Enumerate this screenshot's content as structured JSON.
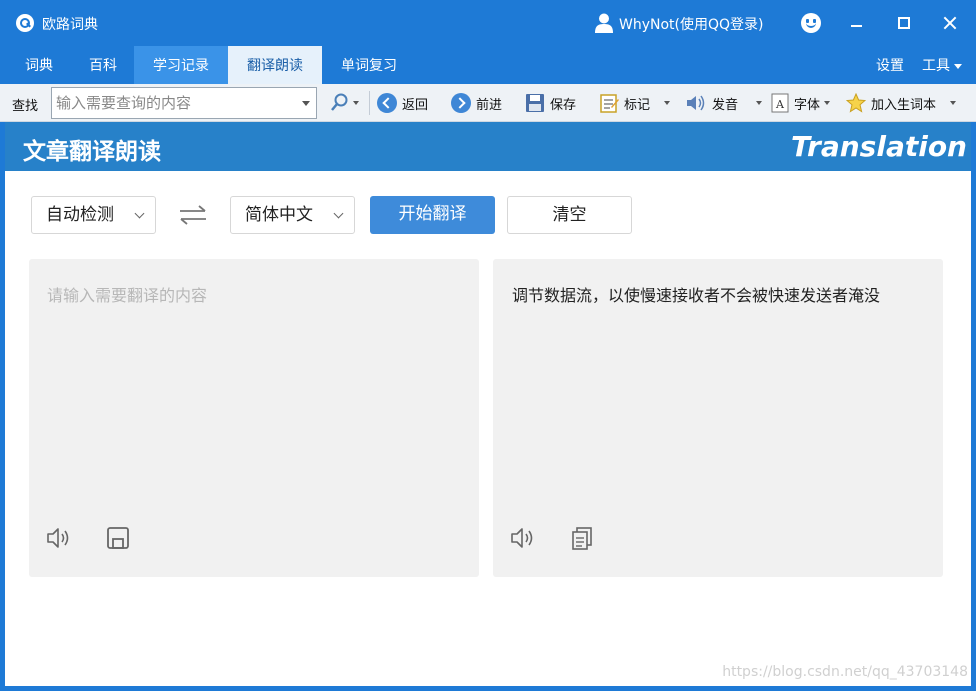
{
  "window": {
    "app_title": "欧路词典",
    "user_label": "WhyNot(使用QQ登录)",
    "icons": [
      "app-logo-icon",
      "user-icon",
      "smile-icon",
      "minimize-icon",
      "maximize-icon",
      "close-icon"
    ]
  },
  "tabs": [
    {
      "label": "词典",
      "state": "normal"
    },
    {
      "label": "百科",
      "state": "normal"
    },
    {
      "label": "学习记录",
      "state": "hover"
    },
    {
      "label": "翻译朗读",
      "state": "active"
    },
    {
      "label": "单词复习",
      "state": "normal"
    }
  ],
  "tab_right": {
    "settings": "设置",
    "tools": "工具"
  },
  "toolbar": {
    "search_label": "查找",
    "search_placeholder": "输入需要查询的内容",
    "back": "返回",
    "forward": "前进",
    "save": "保存",
    "mark": "标记",
    "pronounce": "发音",
    "font": "字体",
    "add_wordbook": "加入生词本"
  },
  "banner": {
    "title": "文章翻译朗读",
    "subtitle": "Translation"
  },
  "controls": {
    "source_lang": "自动检测",
    "target_lang": "简体中文",
    "translate_button": "开始翻译",
    "clear_button": "清空"
  },
  "input_panel": {
    "placeholder": "请输入需要翻译的内容",
    "value": ""
  },
  "output_panel": {
    "text": "调节数据流，以使慢速接收者不会被快速发送者淹没"
  },
  "watermark": "https://blog.csdn.net/qq_43703148",
  "colors": {
    "titlebar": "#1e7ad6",
    "banner": "#2781c9",
    "primary_button": "#3e8bda",
    "panel_bg": "#f1f1f1"
  }
}
